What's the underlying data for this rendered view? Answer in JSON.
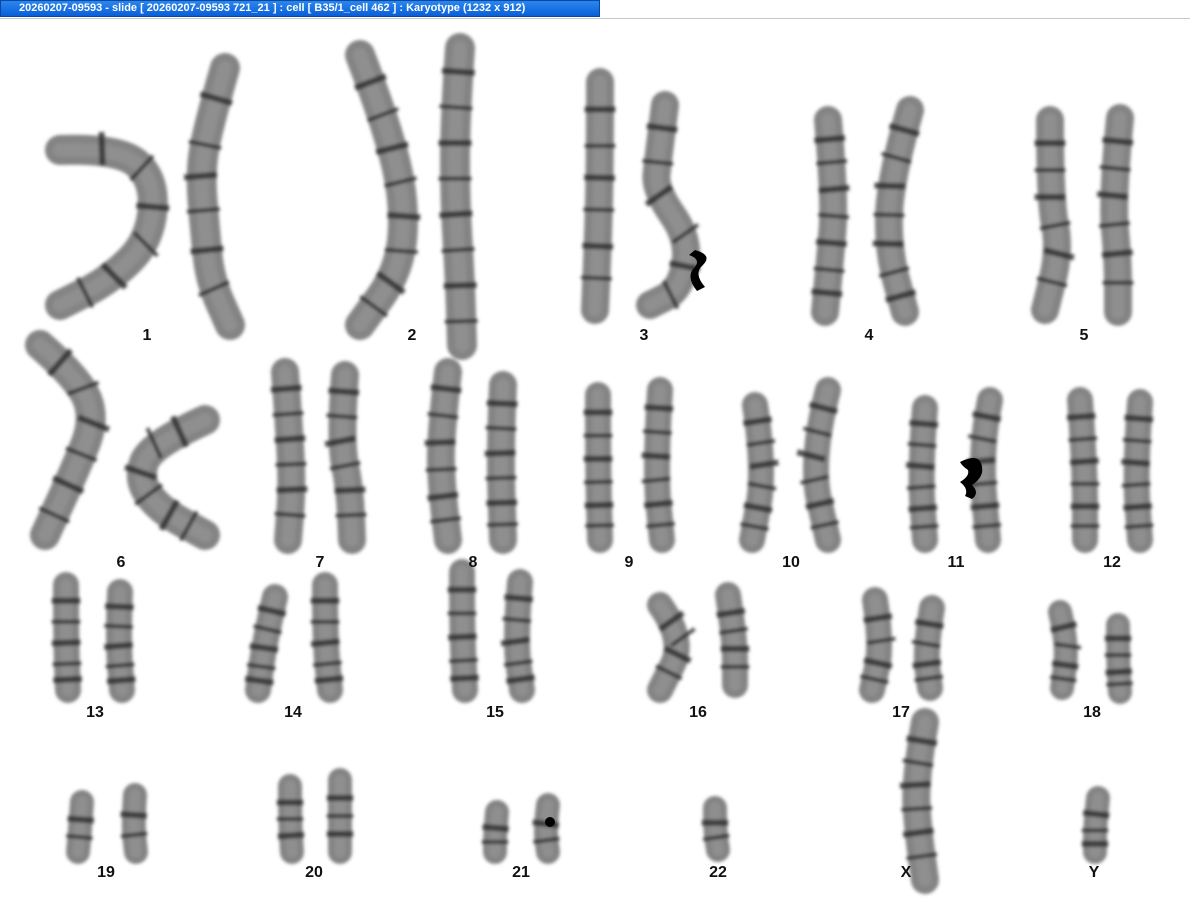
{
  "window": {
    "title": "20260207-09593 - slide [ 20260207-09593 721_21 ] : cell [ B35/1_cell 462 ] : Karyotype  (1232 x 912)"
  },
  "colors": {
    "titlebar": "#0a5fd6",
    "titlebar_text": "#ffffff",
    "chromosome": "#6e6e6e",
    "band": "#2a2a2a",
    "probe_signal": "#000000"
  },
  "karyotype": {
    "labels": {
      "c1": "1",
      "c2": "2",
      "c3": "3",
      "c4": "4",
      "c5": "5",
      "c6": "6",
      "c7": "7",
      "c8": "8",
      "c9": "9",
      "c10": "10",
      "c11": "11",
      "c12": "12",
      "c13": "13",
      "c14": "14",
      "c15": "15",
      "c16": "16",
      "c17": "17",
      "c18": "18",
      "c19": "19",
      "c20": "20",
      "c21": "21",
      "c22": "22",
      "cx": "X",
      "cy": "Y"
    }
  }
}
